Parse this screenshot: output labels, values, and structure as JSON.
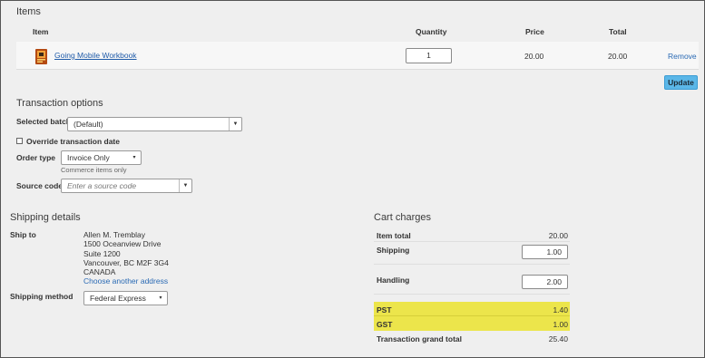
{
  "items_section": {
    "title": "Items",
    "columns": {
      "item": "Item",
      "quantity": "Quantity",
      "price": "Price",
      "total": "Total"
    },
    "rows": [
      {
        "name": "Going Mobile Workbook",
        "quantity": "1",
        "price": "20.00",
        "total": "20.00",
        "remove": "Remove",
        "icon": "book-icon"
      }
    ],
    "update_label": "Update"
  },
  "transaction_options": {
    "title": "Transaction options",
    "selected_batch_label": "Selected batch",
    "selected_batch_value": "(Default)",
    "override_label": "Override transaction date",
    "order_type_label": "Order type",
    "order_type_value": "Invoice Only",
    "order_type_note": "Commerce items only",
    "source_code_label": "Source code",
    "source_code_placeholder": "Enter a source code"
  },
  "shipping": {
    "title": "Shipping details",
    "ship_to_label": "Ship to",
    "address_lines": [
      "Allen M. Tremblay",
      "1500 Oceanview Drive",
      "Suite 1200",
      "Vancouver, BC M2F 3G4",
      "CANADA"
    ],
    "choose_address": "Choose another address",
    "method_label": "Shipping method",
    "method_value": "Federal Express"
  },
  "cart_charges": {
    "title": "Cart charges",
    "item_total_label": "Item total",
    "item_total": "20.00",
    "shipping_label": "Shipping",
    "shipping_value": "1.00",
    "handling_label": "Handling",
    "handling_value": "2.00",
    "pst_label": "PST",
    "pst_value": "1.40",
    "gst_label": "GST",
    "gst_value": "1.00",
    "grand_total_label": "Transaction grand total",
    "grand_total": "25.40",
    "highlight_color": "#ece54b"
  },
  "colors": {
    "update_button": "#5bb7e8",
    "link": "#1e5aa8"
  }
}
